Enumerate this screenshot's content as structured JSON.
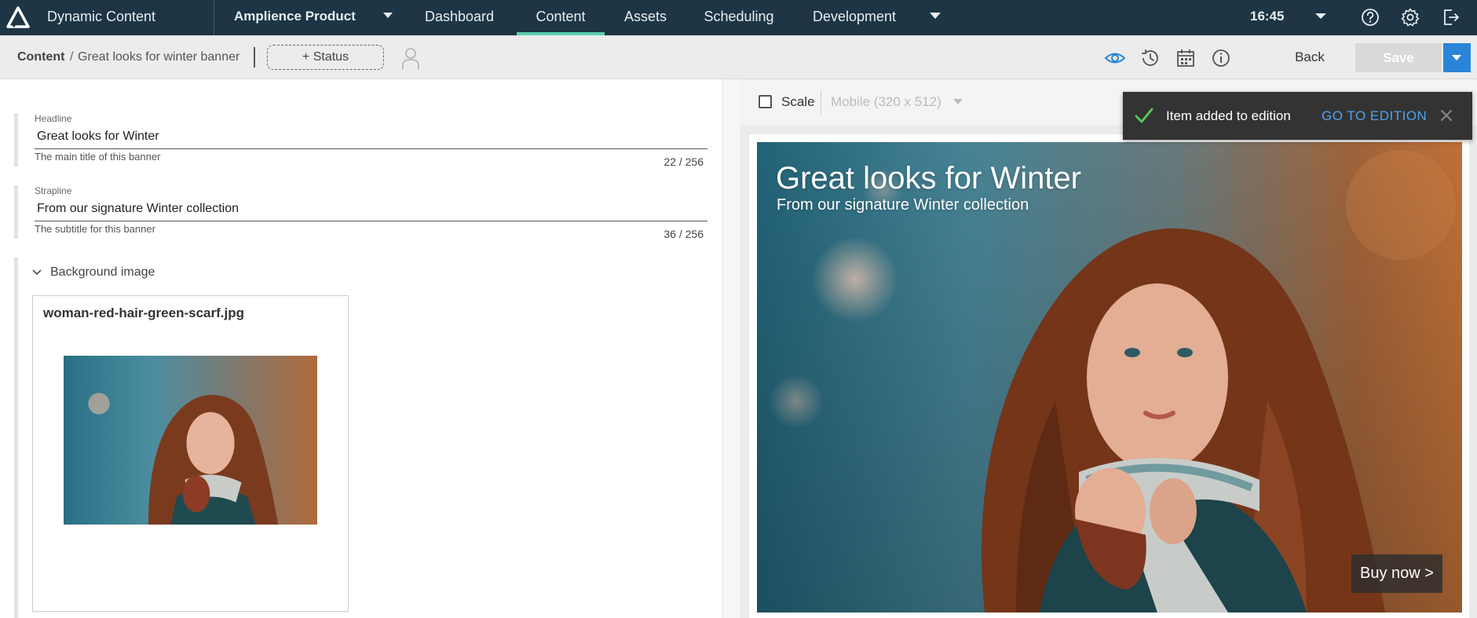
{
  "nav": {
    "app_name": "Dynamic Content",
    "hub_name": "Amplience Product",
    "tabs": [
      {
        "label": "Dashboard"
      },
      {
        "label": "Content"
      },
      {
        "label": "Assets"
      },
      {
        "label": "Scheduling"
      },
      {
        "label": "Development"
      }
    ],
    "active_tab": "Content",
    "time": "16:45",
    "accent_color": "#5ed0b0",
    "bar_color": "#1d3545"
  },
  "toolbar": {
    "breadcrumb_root": "Content",
    "breadcrumb_sep": "/",
    "breadcrumb_item": "Great looks for winter banner",
    "status_button": "+ Status",
    "back_label": "Back",
    "save_label": "Save",
    "icons": [
      "eye-icon",
      "history-icon",
      "calendar-icon",
      "info-icon"
    ]
  },
  "editor": {
    "headline": {
      "label": "Headline",
      "value": "Great looks for Winter",
      "help": "The main title of this banner",
      "count": "22 / 256"
    },
    "strapline": {
      "label": "Strapline",
      "value": "From our signature Winter collection",
      "help": "The subtitle for this banner",
      "count": "36 / 256"
    },
    "background": {
      "section_title": "Background image",
      "asset_name": "woman-red-hair-green-scarf.jpg"
    }
  },
  "preview": {
    "scale_label": "Scale",
    "scale_checked": false,
    "device": "Mobile (320 x 512)",
    "banner_headline": "Great looks for Winter",
    "banner_strapline": "From our signature Winter collection",
    "cta": "Buy now >"
  },
  "toast": {
    "message": "Item added to edition",
    "link": "GO TO EDITION",
    "link_color": "#4fa3f0"
  }
}
